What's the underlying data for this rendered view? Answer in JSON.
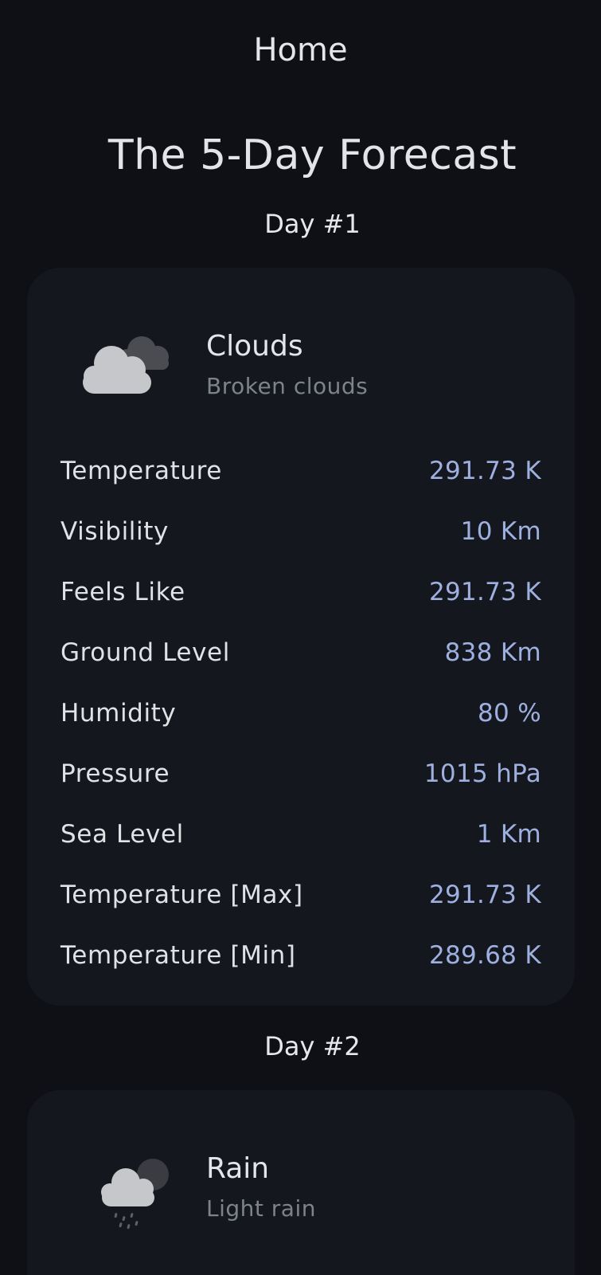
{
  "header": {
    "title": "Home"
  },
  "page": {
    "title": "The 5-Day Forecast"
  },
  "days": [
    {
      "label": "Day #1",
      "condition": "Clouds",
      "description": "Broken clouds",
      "icon": "broken-clouds-icon",
      "stats": [
        {
          "label": "Temperature",
          "value": "291.73 K"
        },
        {
          "label": "Visibility",
          "value": "10 Km"
        },
        {
          "label": "Feels Like",
          "value": "291.73 K"
        },
        {
          "label": "Ground Level",
          "value": "838 Km"
        },
        {
          "label": "Humidity",
          "value": "80 %"
        },
        {
          "label": "Pressure",
          "value": "1015 hPa"
        },
        {
          "label": "Sea Level",
          "value": "1 Km"
        },
        {
          "label": "Temperature [Max]",
          "value": "291.73 K"
        },
        {
          "label": "Temperature [Min]",
          "value": "289.68 K"
        }
      ]
    },
    {
      "label": "Day #2",
      "condition": "Rain",
      "description": "Light rain",
      "icon": "light-rain-icon"
    }
  ],
  "colors": {
    "background": "#0e1016",
    "card": "#15171e",
    "value_accent": "#9eb0e0",
    "muted_text": "#7e8289"
  }
}
